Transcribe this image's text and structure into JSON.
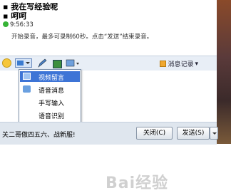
{
  "chat": {
    "line1": "我在写经验呢",
    "line2": "呵呵",
    "time": "9:56:33",
    "hint": "开始录音，最多可录制60秒。点击“发送”结束录音。"
  },
  "toolbar": {
    "history_label": "消息记录"
  },
  "menu": {
    "items": [
      "视频留言",
      "语音消息",
      "手写输入",
      "语音识别"
    ]
  },
  "input": {
    "watermark": "Bai经验"
  },
  "bottom": {
    "nickname": "关二哥傲四五六、战新服!",
    "close_label": "关闭(C)",
    "send_label": "发送(S)"
  },
  "colors": {
    "menu_selected": "#3d74d6",
    "toolbar_bg": "#e8eef6"
  }
}
